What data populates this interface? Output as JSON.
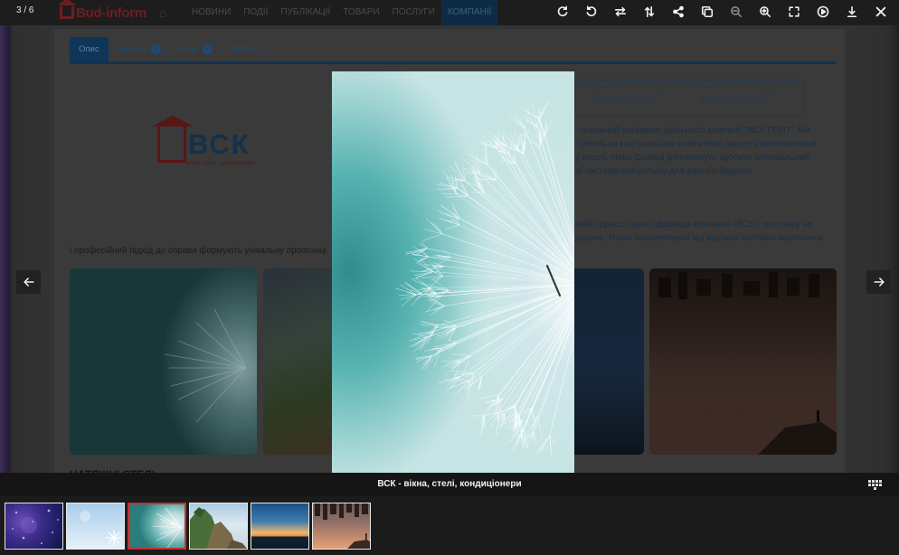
{
  "viewer": {
    "counter": "3 / 6",
    "caption": "ВСК - вікна, стелі, кондиціонери",
    "toolbar": [
      {
        "name": "rotate-cw-icon",
        "label": "rotate clockwise"
      },
      {
        "name": "rotate-ccw-icon",
        "label": "rotate counterclockwise"
      },
      {
        "name": "flip-horizontal-icon",
        "label": "flip horizontal"
      },
      {
        "name": "flip-vertical-icon",
        "label": "flip vertical"
      },
      {
        "name": "share-icon",
        "label": "share"
      },
      {
        "name": "copy-icon",
        "label": "copy"
      },
      {
        "name": "zoom-out-icon",
        "label": "zoom out"
      },
      {
        "name": "zoom-in-icon",
        "label": "zoom in"
      },
      {
        "name": "fullscreen-icon",
        "label": "fullscreen"
      },
      {
        "name": "play-icon",
        "label": "slideshow"
      },
      {
        "name": "download-icon",
        "label": "download"
      },
      {
        "name": "close-icon",
        "label": "close"
      }
    ],
    "thumbnails": [
      {
        "theme": "purple-bokeh",
        "active": false
      },
      {
        "theme": "snowflake-sky",
        "active": false
      },
      {
        "theme": "dandelion",
        "active": true
      },
      {
        "theme": "cliffs-sea",
        "active": false
      },
      {
        "theme": "sunset-sea",
        "active": false
      },
      {
        "theme": "city-aerial",
        "active": false
      }
    ]
  },
  "site": {
    "logo": "Bud-inform",
    "nav": [
      "НОВИНИ",
      "ПОДІЇ",
      "ПУБЛІКАЦІЇ",
      "ТОВАРИ",
      "ПОСЛУГИ",
      "КОМПАНІЇ"
    ],
    "active_nav": "КОМПАНІЇ"
  },
  "company": {
    "tabs": [
      {
        "label": "Опис",
        "count": ""
      },
      {
        "label": "Новини",
        "count": "0"
      },
      {
        "label": "Акції",
        "count": "0"
      },
      {
        "label": "Відгуки",
        "count": ""
      }
    ],
    "logo_text": "ВСК",
    "logo_tagline": "вікна · стелі · кондиціонери",
    "ratings": [
      {
        "label": "Сервіс",
        "stars": "☆☆☆☆☆",
        "score": "0.0"
      },
      {
        "label": "Ціни",
        "stars": "☆☆☆☆☆",
        "score": "0.0"
      }
    ],
    "description_lines": [
      "- основний напрямок діяльності компанії \"ВСК ГРУП\". Ми",
      "і ретельно контролюємо кожен етап процесу виготовлення",
      "у якості. Наші фахівці допоможуть зробити оптимальний",
      "ої системи спеціально для вашого будинку."
    ],
    "mastery_lines": [
      "майстерності своїх фахівців компанія «ВСК» пропонує не",
      "рішень. Якісні комплектуючі від відомих світових виробників"
    ],
    "approach_line": "і професійний підхід до справи формують унікальну пропозиці",
    "section_heading": "НАТЯЖНІ СТЕЛІ"
  },
  "colors": {
    "accent_red": "#c3302c",
    "toolbar_bg": "#1b1b1b",
    "site_blue": "#0e2b45"
  }
}
